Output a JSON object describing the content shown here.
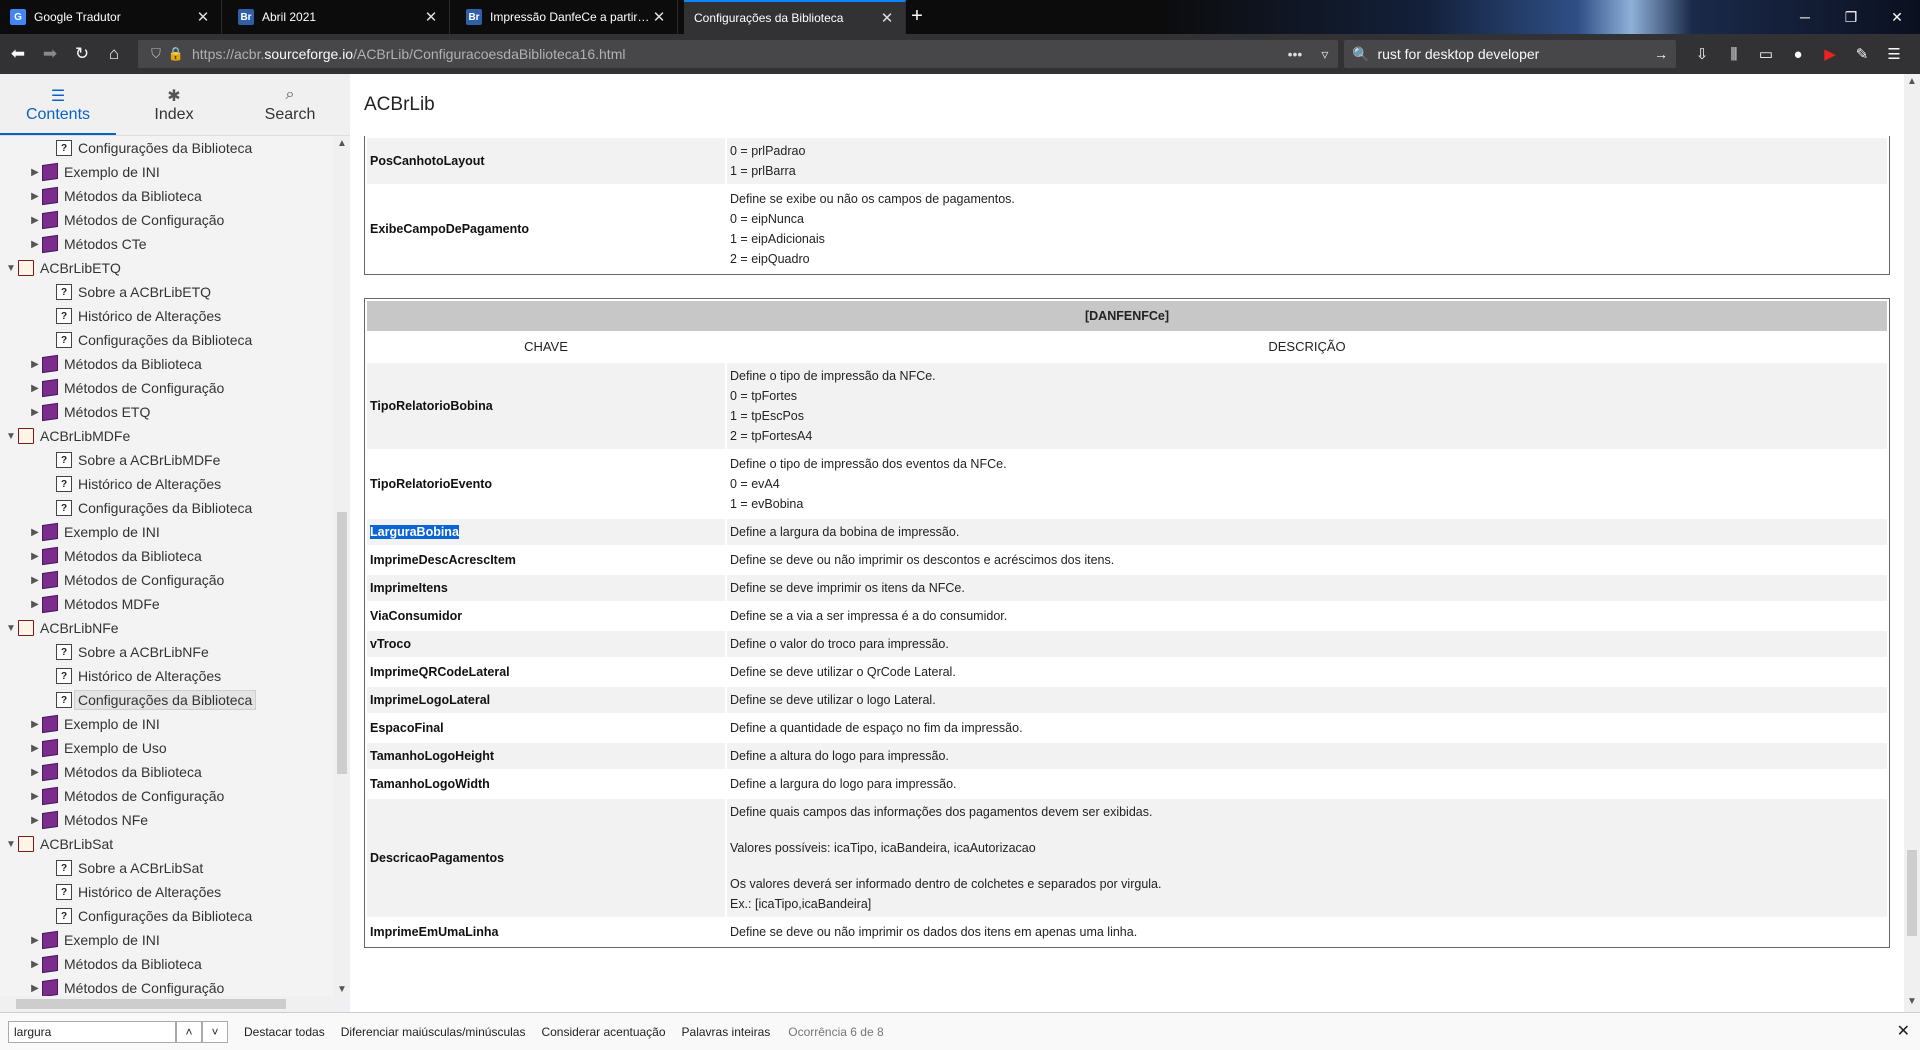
{
  "tabs": [
    {
      "label": "Google Tradutor",
      "icon": "google-translate-icon",
      "color": "#4285f4",
      "glyph": "G"
    },
    {
      "label": "Abril 2021",
      "icon": "br-icon",
      "color": "#2f5fa8",
      "glyph": "Br"
    },
    {
      "label": "Impressão DanfeCe a partir do",
      "icon": "br-icon",
      "color": "#2f5fa8",
      "glyph": "Br"
    },
    {
      "label": "Configurações da Biblioteca",
      "icon": null,
      "color": null,
      "glyph": ""
    }
  ],
  "navbar": {
    "url_prefix": "https://acbr.",
    "url_domain": "sourceforge.io",
    "url_path": "/ACBrLib/ConfiguracoesdaBiblioteca16.html",
    "search_value": "rust for desktop developer"
  },
  "helptabs": [
    {
      "label": "Contents",
      "icon": "contents-icon"
    },
    {
      "label": "Index",
      "icon": "index-icon"
    },
    {
      "label": "Search",
      "icon": "search-icon"
    }
  ],
  "tree": [
    {
      "label": "Configurações da Biblioteca",
      "type": "page",
      "level": 2,
      "twisty": ""
    },
    {
      "label": "Exemplo de INI",
      "type": "book",
      "level": 1,
      "twisty": "▶"
    },
    {
      "label": "Métodos da Biblioteca",
      "type": "book",
      "level": 1,
      "twisty": "▶"
    },
    {
      "label": "Métodos de Configuração",
      "type": "book",
      "level": 1,
      "twisty": "▶"
    },
    {
      "label": "Métodos CTe",
      "type": "book",
      "level": 1,
      "twisty": "▶"
    },
    {
      "label": "ACBrLibETQ",
      "type": "openbook",
      "level": 0,
      "twisty": "▼"
    },
    {
      "label": "Sobre a ACBrLibETQ",
      "type": "page",
      "level": 2,
      "twisty": ""
    },
    {
      "label": "Histórico de Alterações",
      "type": "page",
      "level": 2,
      "twisty": ""
    },
    {
      "label": "Configurações da Biblioteca",
      "type": "page",
      "level": 2,
      "twisty": ""
    },
    {
      "label": "Métodos da Biblioteca",
      "type": "book",
      "level": 1,
      "twisty": "▶"
    },
    {
      "label": "Métodos de Configuração",
      "type": "book",
      "level": 1,
      "twisty": "▶"
    },
    {
      "label": "Métodos ETQ",
      "type": "book",
      "level": 1,
      "twisty": "▶"
    },
    {
      "label": "ACBrLibMDFe",
      "type": "openbook",
      "level": 0,
      "twisty": "▼"
    },
    {
      "label": "Sobre a ACBrLibMDFe",
      "type": "page",
      "level": 2,
      "twisty": ""
    },
    {
      "label": "Histórico de Alterações",
      "type": "page",
      "level": 2,
      "twisty": ""
    },
    {
      "label": "Configurações da Biblioteca",
      "type": "page",
      "level": 2,
      "twisty": ""
    },
    {
      "label": "Exemplo de INI",
      "type": "book",
      "level": 1,
      "twisty": "▶"
    },
    {
      "label": "Métodos da Biblioteca",
      "type": "book",
      "level": 1,
      "twisty": "▶"
    },
    {
      "label": "Métodos de Configuração",
      "type": "book",
      "level": 1,
      "twisty": "▶"
    },
    {
      "label": "Métodos MDFe",
      "type": "book",
      "level": 1,
      "twisty": "▶"
    },
    {
      "label": "ACBrLibNFe",
      "type": "openbook",
      "level": 0,
      "twisty": "▼"
    },
    {
      "label": "Sobre a ACBrLibNFe",
      "type": "page",
      "level": 2,
      "twisty": ""
    },
    {
      "label": "Histórico de Alterações",
      "type": "page",
      "level": 2,
      "twisty": ""
    },
    {
      "label": "Configurações da Biblioteca",
      "type": "page",
      "level": 2,
      "twisty": "",
      "selected": true
    },
    {
      "label": "Exemplo de INI",
      "type": "book",
      "level": 1,
      "twisty": "▶"
    },
    {
      "label": "Exemplo de Uso",
      "type": "book",
      "level": 1,
      "twisty": "▶"
    },
    {
      "label": "Métodos da Biblioteca",
      "type": "book",
      "level": 1,
      "twisty": "▶"
    },
    {
      "label": "Métodos de Configuração",
      "type": "book",
      "level": 1,
      "twisty": "▶"
    },
    {
      "label": "Métodos NFe",
      "type": "book",
      "level": 1,
      "twisty": "▶"
    },
    {
      "label": "ACBrLibSat",
      "type": "openbook",
      "level": 0,
      "twisty": "▼"
    },
    {
      "label": "Sobre a ACBrLibSat",
      "type": "page",
      "level": 2,
      "twisty": ""
    },
    {
      "label": "Histórico de Alterações",
      "type": "page",
      "level": 2,
      "twisty": ""
    },
    {
      "label": "Configurações da Biblioteca",
      "type": "page",
      "level": 2,
      "twisty": ""
    },
    {
      "label": "Exemplo de INI",
      "type": "book",
      "level": 1,
      "twisty": "▶"
    },
    {
      "label": "Métodos da Biblioteca",
      "type": "book",
      "level": 1,
      "twisty": "▶"
    },
    {
      "label": "Métodos de Configuração",
      "type": "book",
      "level": 1,
      "twisty": "▶"
    }
  ],
  "content": {
    "title": "ACBrLib",
    "prev_rows": [
      {
        "key": "PosCanhotoLayout",
        "desc": [
          "0 = prlPadrao",
          "1 = prlBarra"
        ],
        "alt": true
      },
      {
        "key": "ExibeCampoDePagamento",
        "desc": [
          "Define se exibe ou não os campos de pagamentos.",
          "0 = eipNunca",
          "1 = eipAdicionais",
          "2 = eipQuadro"
        ],
        "alt": false
      }
    ],
    "section_header": "[DANFENFCe]",
    "col_key": "CHAVE",
    "col_desc": "DESCRIÇÃO",
    "rows": [
      {
        "key": "TipoRelatorioBobina",
        "desc": [
          "Define o tipo de impressão da NFCe.",
          "0 = tpFortes",
          "1 = tpEscPos",
          "2 = tpFortesA4"
        ],
        "alt": true
      },
      {
        "key": "TipoRelatorioEvento",
        "desc": [
          "Define o tipo de impressão dos eventos da NFCe.",
          "0 = evA4",
          "1 = evBobina"
        ],
        "alt": false
      },
      {
        "key": "LarguraBobina",
        "desc": [
          "Define a largura da bobina de impressão."
        ],
        "alt": true,
        "highlight": true
      },
      {
        "key": "ImprimeDescAcrescItem",
        "desc": [
          "Define se deve ou não imprimir os descontos e acréscimos dos itens."
        ],
        "alt": false
      },
      {
        "key": "ImprimeItens",
        "desc": [
          "Define se deve imprimir os itens da NFCe."
        ],
        "alt": true
      },
      {
        "key": "ViaConsumidor",
        "desc": [
          "Define se a via a ser impressa é a do consumidor."
        ],
        "alt": false
      },
      {
        "key": "vTroco",
        "desc": [
          "Define o valor do troco para impressão."
        ],
        "alt": true
      },
      {
        "key": "ImprimeQRCodeLateral",
        "desc": [
          "Define se deve utilizar o QrCode Lateral."
        ],
        "alt": false
      },
      {
        "key": "ImprimeLogoLateral",
        "desc": [
          "Define se deve utilizar o logo Lateral."
        ],
        "alt": true
      },
      {
        "key": "EspacoFinal",
        "desc": [
          "Define a quantidade de espaço no fim da impressão."
        ],
        "alt": false
      },
      {
        "key": "TamanhoLogoHeight",
        "desc": [
          "Define a altura do logo para impressão."
        ],
        "alt": true
      },
      {
        "key": "TamanhoLogoWidth",
        "desc": [
          "Define a largura do logo para impressão."
        ],
        "alt": false
      },
      {
        "key": "DescricaoPagamentos",
        "desc": [
          "Define quais campos das informações dos pagamentos devem ser exibidas.",
          "",
          "Valores possíveis: icaTipo, icaBandeira, icaAutorizacao",
          "",
          "Os valores deverá ser informado dentro de colchetes e separados por virgula.",
          "Ex.: [icaTipo,icaBandeira]"
        ],
        "alt": true
      },
      {
        "key": "ImprimeEmUmaLinha",
        "desc": [
          "Define se deve ou não imprimir os dados dos itens em apenas uma linha."
        ],
        "alt": false
      }
    ]
  },
  "findbar": {
    "value": "largura",
    "opt_highlight": "Destacar todas",
    "opt_case": "Diferenciar maiúsculas/minúsculas",
    "opt_accent": "Considerar acentuação",
    "opt_whole": "Palavras inteiras",
    "status": "Ocorrência 6 de 8"
  }
}
